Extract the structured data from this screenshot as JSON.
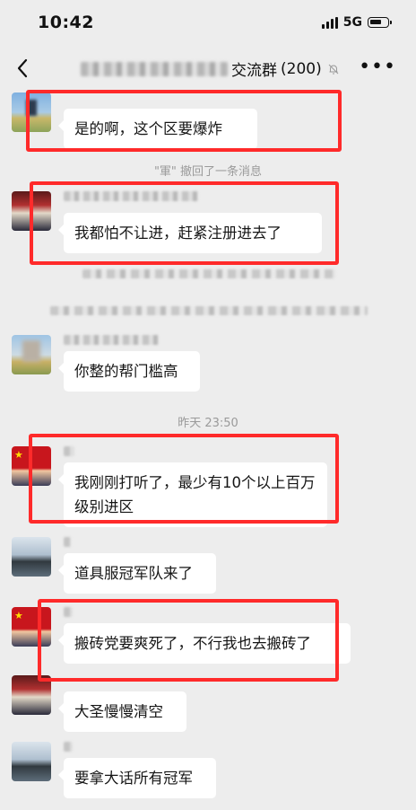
{
  "status_bar": {
    "time": "10:42",
    "network": "5G"
  },
  "nav": {
    "title_suffix": "交流群",
    "member_count": "(200)"
  },
  "messages": [
    {
      "text": "是的啊，这个区要爆炸"
    },
    {
      "text": "我都怕不让进，赶紧注册进去了"
    },
    {
      "text": "你整的帮门槛高"
    },
    {
      "text": "我刚刚打听了，最少有10个以上百万级别进区"
    },
    {
      "text": "道具服冠军队来了"
    },
    {
      "text": "搬砖党要爽死了，不行我也去搬砖了"
    },
    {
      "text": "大圣慢慢清空"
    },
    {
      "text": "要拿大话所有冠军"
    }
  ],
  "system": {
    "recall_notice": "\"軍\" 撤回了一条消息",
    "timestamp": "昨天 23:50"
  },
  "colors": {
    "highlight": "#ff2a2a",
    "background": "#ededed",
    "bubble": "#ffffff"
  }
}
